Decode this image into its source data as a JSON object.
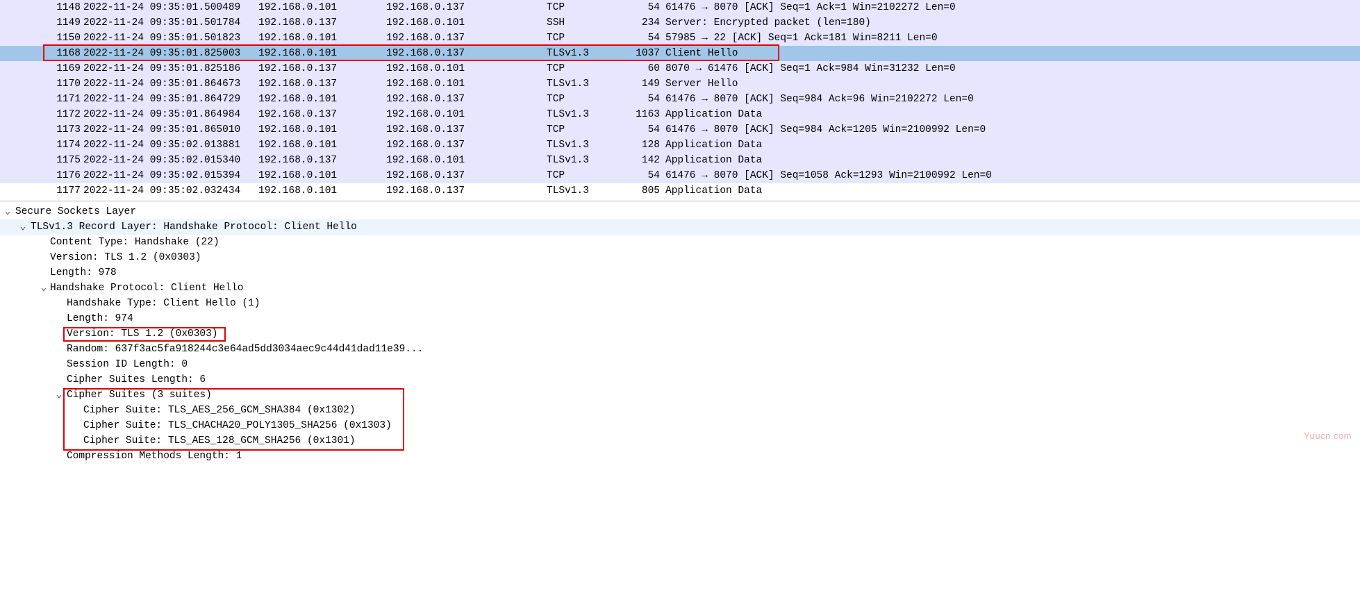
{
  "packets": [
    {
      "no": "1148",
      "time": "2022-11-24 09:35:01.500489",
      "src": "192.168.0.101",
      "dst": "192.168.0.137",
      "proto": "TCP",
      "len": "54",
      "info": "61476 → 8070 [ACK] Seq=1 Ack=1 Win=2102272 Len=0",
      "bg": "bg-purple",
      "sel": false
    },
    {
      "no": "1149",
      "time": "2022-11-24 09:35:01.501784",
      "src": "192.168.0.137",
      "dst": "192.168.0.101",
      "proto": "SSH",
      "len": "234",
      "info": "Server: Encrypted packet (len=180)",
      "bg": "bg-purple",
      "sel": false
    },
    {
      "no": "1150",
      "time": "2022-11-24 09:35:01.501823",
      "src": "192.168.0.101",
      "dst": "192.168.0.137",
      "proto": "TCP",
      "len": "54",
      "info": "57985 → 22 [ACK] Seq=1 Ack=181 Win=8211 Len=0",
      "bg": "bg-purple",
      "sel": false
    },
    {
      "no": "1168",
      "time": "2022-11-24 09:35:01.825003",
      "src": "192.168.0.101",
      "dst": "192.168.0.137",
      "proto": "TLSv1.3",
      "len": "1037",
      "info": "Client Hello",
      "bg": "bg-selected",
      "sel": true
    },
    {
      "no": "1169",
      "time": "2022-11-24 09:35:01.825186",
      "src": "192.168.0.137",
      "dst": "192.168.0.101",
      "proto": "TCP",
      "len": "60",
      "info": "8070 → 61476 [ACK] Seq=1 Ack=984 Win=31232 Len=0",
      "bg": "bg-purple",
      "sel": false
    },
    {
      "no": "1170",
      "time": "2022-11-24 09:35:01.864673",
      "src": "192.168.0.137",
      "dst": "192.168.0.101",
      "proto": "TLSv1.3",
      "len": "149",
      "info": "Server Hello",
      "bg": "bg-purple",
      "sel": false
    },
    {
      "no": "1171",
      "time": "2022-11-24 09:35:01.864729",
      "src": "192.168.0.101",
      "dst": "192.168.0.137",
      "proto": "TCP",
      "len": "54",
      "info": "61476 → 8070 [ACK] Seq=984 Ack=96 Win=2102272 Len=0",
      "bg": "bg-purple",
      "sel": false
    },
    {
      "no": "1172",
      "time": "2022-11-24 09:35:01.864984",
      "src": "192.168.0.137",
      "dst": "192.168.0.101",
      "proto": "TLSv1.3",
      "len": "1163",
      "info": "Application Data",
      "bg": "bg-purple",
      "sel": false
    },
    {
      "no": "1173",
      "time": "2022-11-24 09:35:01.865010",
      "src": "192.168.0.101",
      "dst": "192.168.0.137",
      "proto": "TCP",
      "len": "54",
      "info": "61476 → 8070 [ACK] Seq=984 Ack=1205 Win=2100992 Len=0",
      "bg": "bg-purple",
      "sel": false
    },
    {
      "no": "1174",
      "time": "2022-11-24 09:35:02.013881",
      "src": "192.168.0.101",
      "dst": "192.168.0.137",
      "proto": "TLSv1.3",
      "len": "128",
      "info": "Application Data",
      "bg": "bg-purple",
      "sel": false
    },
    {
      "no": "1175",
      "time": "2022-11-24 09:35:02.015340",
      "src": "192.168.0.137",
      "dst": "192.168.0.101",
      "proto": "TLSv1.3",
      "len": "142",
      "info": "Application Data",
      "bg": "bg-purple",
      "sel": false
    },
    {
      "no": "1176",
      "time": "2022-11-24 09:35:02.015394",
      "src": "192.168.0.101",
      "dst": "192.168.0.137",
      "proto": "TCP",
      "len": "54",
      "info": "61476 → 8070 [ACK] Seq=1058 Ack=1293 Win=2100992 Len=0",
      "bg": "bg-purple",
      "sel": false
    },
    {
      "no": "1177",
      "time": "2022-11-24 09:35:02.032434",
      "src": "192.168.0.101",
      "dst": "192.168.0.137",
      "proto": "TLSv1.3",
      "len": "805",
      "info": "Application Data",
      "bg": "",
      "sel": false
    }
  ],
  "tree": [
    {
      "indent": 0,
      "toggle": "v",
      "text": "Secure Sockets Layer",
      "sel": false
    },
    {
      "indent": 1,
      "toggle": "v",
      "text": "TLSv1.3 Record Layer: Handshake Protocol: Client Hello",
      "sel": true
    },
    {
      "indent": 2,
      "toggle": "",
      "text": "Content Type: Handshake (22)",
      "sel": false
    },
    {
      "indent": 2,
      "toggle": "",
      "text": "Version: TLS 1.2 (0x0303)",
      "sel": false
    },
    {
      "indent": 2,
      "toggle": "",
      "text": "Length: 978",
      "sel": false
    },
    {
      "indent": 2,
      "toggle": "v",
      "text": "Handshake Protocol: Client Hello",
      "sel": false
    },
    {
      "indent": 3,
      "toggle": "",
      "text": "Handshake Type: Client Hello (1)",
      "sel": false
    },
    {
      "indent": 3,
      "toggle": "",
      "text": "Length: 974",
      "sel": false
    },
    {
      "indent": 3,
      "toggle": "",
      "text": "Version: TLS 1.2 (0x0303)",
      "sel": false
    },
    {
      "indent": 3,
      "toggle": "",
      "text": "Random: 637f3ac5fa918244c3e64ad5dd3034aec9c44d41dad11e39...",
      "sel": false
    },
    {
      "indent": 3,
      "toggle": "",
      "text": "Session ID Length: 0",
      "sel": false
    },
    {
      "indent": 3,
      "toggle": "",
      "text": "Cipher Suites Length: 6",
      "sel": false
    },
    {
      "indent": 3,
      "toggle": "v",
      "text": "Cipher Suites (3 suites)",
      "sel": false
    },
    {
      "indent": 4,
      "toggle": "",
      "text": "Cipher Suite: TLS_AES_256_GCM_SHA384 (0x1302)",
      "sel": false
    },
    {
      "indent": 4,
      "toggle": "",
      "text": "Cipher Suite: TLS_CHACHA20_POLY1305_SHA256 (0x1303)",
      "sel": false
    },
    {
      "indent": 4,
      "toggle": "",
      "text": "Cipher Suite: TLS_AES_128_GCM_SHA256 (0x1301)",
      "sel": false
    },
    {
      "indent": 3,
      "toggle": "",
      "text": "Compression Methods Length: 1",
      "sel": false
    }
  ],
  "watermark": "Yuucn.com"
}
